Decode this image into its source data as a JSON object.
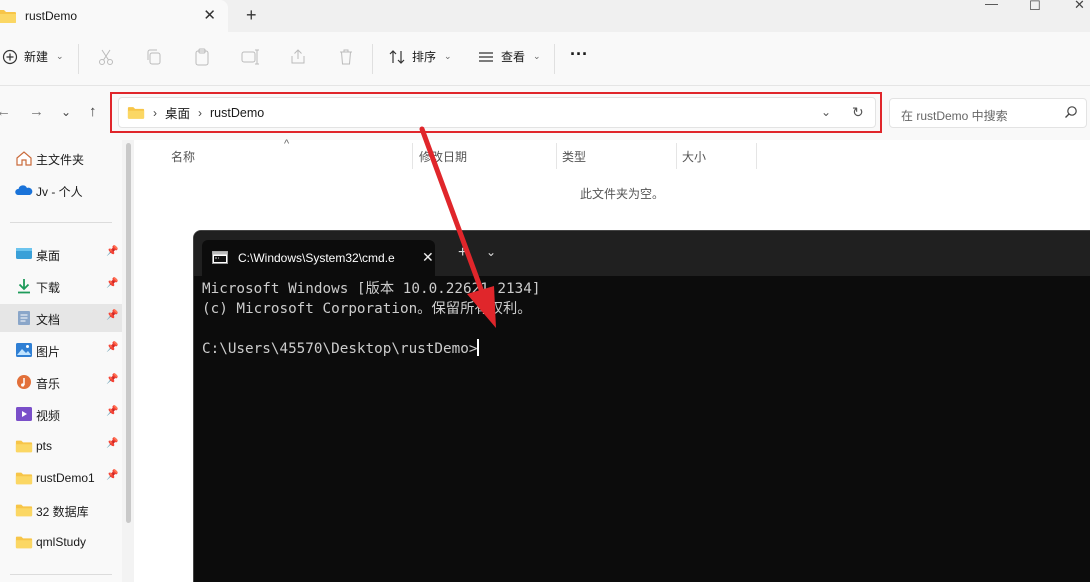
{
  "explorer": {
    "tab_title": "rustDemo",
    "toolbar": {
      "new_label": "新建",
      "sort_label": "排序",
      "view_label": "查看",
      "more_label": "···"
    },
    "breadcrumb": [
      "桌面",
      "rustDemo"
    ],
    "search_placeholder": "在 rustDemo 中搜索",
    "sidebar": {
      "top_items": [
        {
          "label": "主文件夹",
          "icon": "home-icon"
        },
        {
          "label": "Jv - 个人",
          "icon": "onedrive-cloud-icon"
        }
      ],
      "pinned_items": [
        {
          "label": "桌面",
          "icon": "desktop-icon"
        },
        {
          "label": "下载",
          "icon": "download-icon"
        },
        {
          "label": "文档",
          "icon": "document-icon"
        },
        {
          "label": "图片",
          "icon": "picture-icon"
        },
        {
          "label": "音乐",
          "icon": "music-icon"
        },
        {
          "label": "视频",
          "icon": "video-icon"
        },
        {
          "label": "pts",
          "icon": "folder-icon"
        },
        {
          "label": "rustDemo1",
          "icon": "folder-icon"
        },
        {
          "label": "32 数据库",
          "icon": "folder-icon"
        },
        {
          "label": "qmlStudy",
          "icon": "folder-icon"
        }
      ]
    },
    "columns": [
      "名称",
      "修改日期",
      "类型",
      "大小"
    ],
    "empty_message": "此文件夹为空。"
  },
  "cmd": {
    "tab_title": "C:\\Windows\\System32\\cmd.e",
    "lines": [
      "Microsoft Windows [版本 10.0.22621.2134]",
      "(c) Microsoft Corporation。保留所有权利。",
      "",
      "C:\\Users\\45570\\Desktop\\rustDemo>"
    ]
  },
  "colors": {
    "highlight_red": "#e0262b",
    "folder_yellow": "#f7c548",
    "cmd_bg": "#0c0c0c",
    "cmd_text": "#cccccc"
  }
}
